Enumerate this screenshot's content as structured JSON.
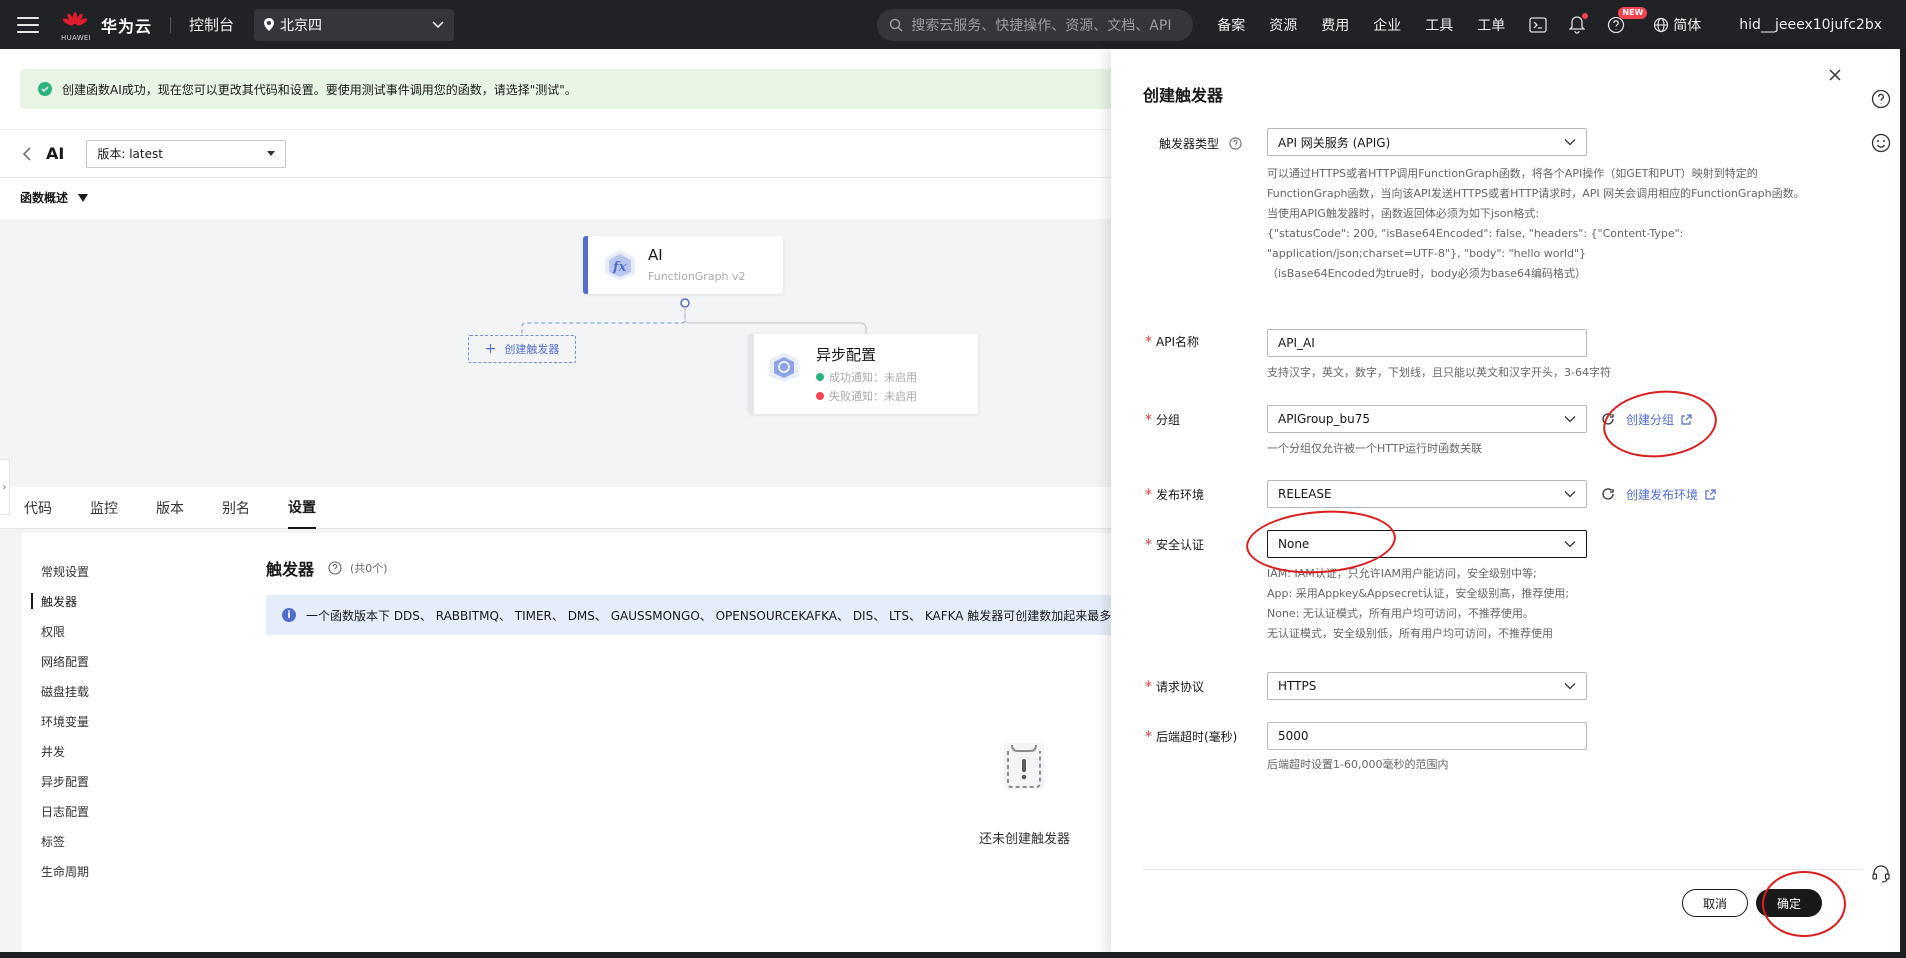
{
  "topbar": {
    "logo_text": "华为云",
    "logo_sub": "HUAWEI",
    "console": "控制台",
    "region": "北京四",
    "search_placeholder": "搜索云服务、快捷操作、资源、文档、API",
    "nav": [
      "备案",
      "资源",
      "费用",
      "企业",
      "工具",
      "工单"
    ],
    "new_badge": "NEW",
    "lang": "简体",
    "user": "hid__jeeex10jufc2bx"
  },
  "alert": {
    "text": "创建函数AI成功，现在您可以更改其代码和设置。要使用测试事件调用您的函数，请选择\"测试\"。"
  },
  "function": {
    "title": "AI",
    "version": "版本: latest",
    "overview": "函数概述"
  },
  "canvas": {
    "fn_name": "AI",
    "fn_sub": "FunctionGraph v2",
    "create_trigger": "创建触发器",
    "async_title": "异步配置",
    "success": "成功通知：未启用",
    "fail": "失败通知：未启用",
    "colors": {
      "success": "#2bb37d",
      "fail": "#f4434a",
      "accent": "#526ecc"
    }
  },
  "tabs": [
    {
      "label": "代码"
    },
    {
      "label": "监控"
    },
    {
      "label": "版本"
    },
    {
      "label": "别名"
    },
    {
      "label": "设置"
    }
  ],
  "leftmenu": [
    "常规设置",
    "触发器",
    "权限",
    "网络配置",
    "磁盘挂载",
    "环境变量",
    "并发",
    "异步配置",
    "日志配置",
    "标签",
    "生命周期"
  ],
  "panel": {
    "title": "触发器",
    "count": "(共0个)",
    "info": "一个函数版本下 DDS、 RABBITMQ、 TIMER、 DMS、 GAUSSMONGO、 OPENSOURCEKAFKA、 DIS、 LTS、 KAFKA 触发器可创建数加起来最多",
    "empty": "还未创建触发器"
  },
  "drawer": {
    "title": "创建触发器",
    "trigger_type_label": "触发器类型",
    "trigger_type_value": "API 网关服务 (APIG)",
    "trigger_help_1": "可以通过HTTPS或者HTTP调用FunctionGraph函数，将各个API操作（如GET和PUT）映射到特定的FunctionGraph函数，当向该API发送HTTPS或者HTTP请求时，API 网关会调用相应的FunctionGraph函数。",
    "trigger_help_2a": "当使用APIG触发器时，函数返回体必须为如下json格式:",
    "trigger_help_2b": "{\"statusCode\": 200, \"isBase64Encoded\": false, \"headers\": {\"Content-Type\":",
    "trigger_help_2c": "\"application/json;charset=UTF-8\"}, \"body\": \"hello world\"}",
    "trigger_help_2d": "（isBase64Encoded为true时，body必须为base64编码格式）",
    "api_name_label": "API名称",
    "api_name_value": "API_AI",
    "api_name_help": "支持汉字，英文，数字，下划线，且只能以英文和汉字开头，3-64字符",
    "group_label": "分组",
    "group_value": "APIGroup_bu75",
    "group_link": "创建分组",
    "group_help": "一个分组仅允许被一个HTTP运行时函数关联",
    "env_label": "发布环境",
    "env_value": "RELEASE",
    "env_link": "创建发布环境",
    "auth_label": "安全认证",
    "auth_value": "None",
    "auth_help_1": "IAM:   IAM认证，只允许IAM用户能访问，安全级别中等;",
    "auth_help_2": "App:   采用Appkey&Appsecret认证，安全级别高，推荐使用;",
    "auth_help_3": "None:   无认证模式，所有用户均可访问，不推荐使用。",
    "auth_help_4": "无认证模式，安全级别低，所有用户均可访问，不推荐使用",
    "protocol_label": "请求协议",
    "protocol_value": "HTTPS",
    "timeout_label": "后端超时(毫秒)",
    "timeout_value": "5000",
    "timeout_help": "后端超时设置1-60,000毫秒的范围内",
    "cancel": "取消",
    "ok": "确定"
  }
}
